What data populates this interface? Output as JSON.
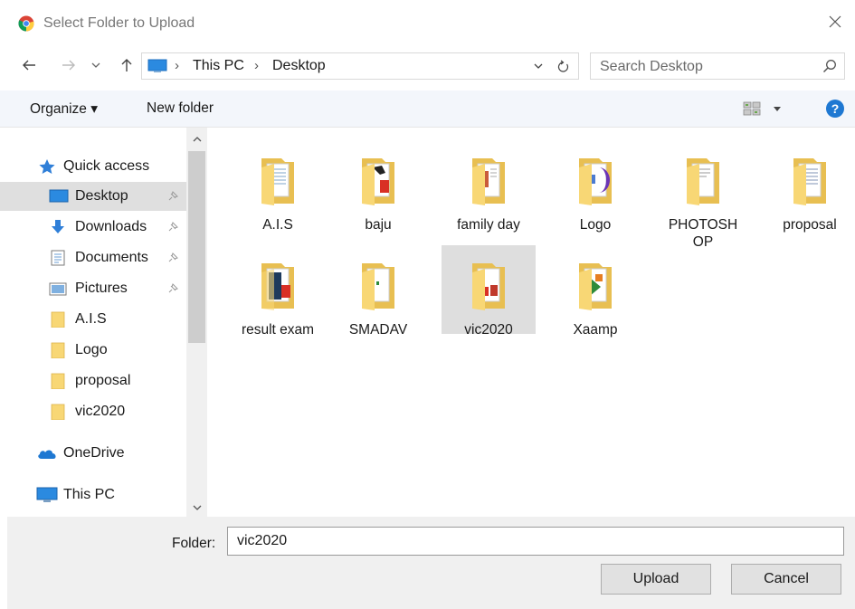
{
  "window": {
    "title": "Select Folder to Upload"
  },
  "address": {
    "crumbs": [
      "This PC",
      "Desktop"
    ]
  },
  "search": {
    "placeholder": "Search Desktop"
  },
  "toolbar": {
    "organize_label": "Organize ▾",
    "new_folder_label": "New folder"
  },
  "nav": {
    "items": [
      {
        "label": "Quick access",
        "icon": "star-icon"
      },
      {
        "label": "Desktop",
        "icon": "desktop-icon",
        "pinned": true,
        "selected": true
      },
      {
        "label": "Downloads",
        "icon": "download-icon",
        "pinned": true
      },
      {
        "label": "Documents",
        "icon": "documents-icon",
        "pinned": true
      },
      {
        "label": "Pictures",
        "icon": "pictures-icon",
        "pinned": true
      },
      {
        "label": "A.I.S",
        "icon": "folder-icon"
      },
      {
        "label": "Logo",
        "icon": "folder-icon"
      },
      {
        "label": "proposal",
        "icon": "folder-icon"
      },
      {
        "label": "vic2020",
        "icon": "folder-icon"
      },
      {
        "label": "OneDrive",
        "icon": "cloud-icon"
      },
      {
        "label": "This PC",
        "icon": "computer-icon"
      }
    ]
  },
  "files": [
    {
      "name": "A.I.S",
      "icon": "folder-icon"
    },
    {
      "name": "baju",
      "icon": "folder-icon"
    },
    {
      "name": "family day",
      "icon": "folder-icon"
    },
    {
      "name": "Logo",
      "icon": "folder-icon"
    },
    {
      "name": "PHOTOSHOP",
      "icon": "folder-icon"
    },
    {
      "name": "proposal",
      "icon": "folder-icon"
    },
    {
      "name": "result exam",
      "icon": "folder-icon"
    },
    {
      "name": "SMADAV",
      "icon": "folder-icon"
    },
    {
      "name": "vic2020",
      "icon": "folder-icon",
      "selected": true
    },
    {
      "name": "Xaamp",
      "icon": "folder-icon"
    }
  ],
  "footer": {
    "folder_label": "Folder:",
    "folder_value": "vic2020",
    "upload_label": "Upload",
    "cancel_label": "Cancel"
  },
  "colors": {
    "accent": "#0078d7",
    "folder": "#f8d775",
    "selection": "#dedede"
  }
}
